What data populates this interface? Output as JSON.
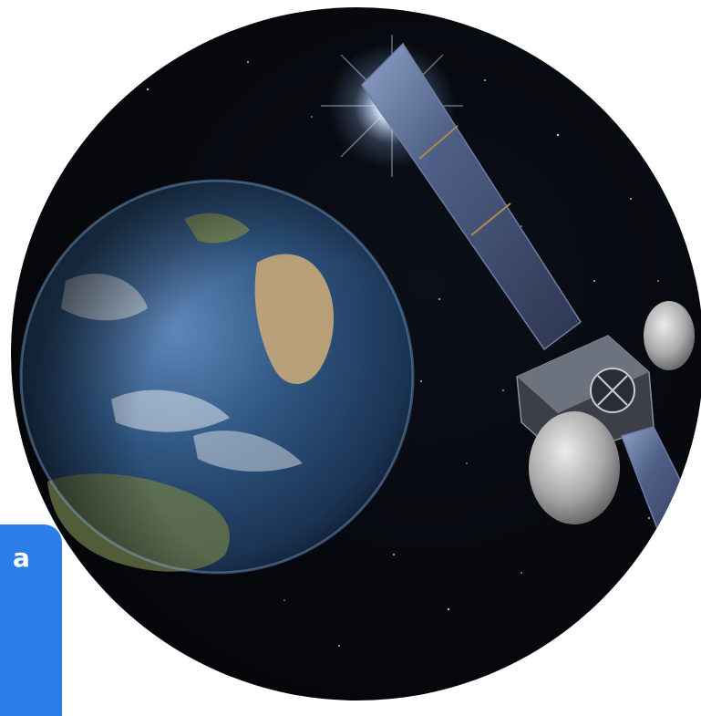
{
  "badge": {
    "text": "a",
    "color": "#2b7de9"
  },
  "scene": {
    "subjects": [
      "earth",
      "satellite",
      "sun-flare",
      "star-field"
    ],
    "colors": {
      "space": "#05070c",
      "ocean": "#2a4f7a",
      "land": "#b89a6a",
      "panel": "#3a4a6b"
    }
  }
}
